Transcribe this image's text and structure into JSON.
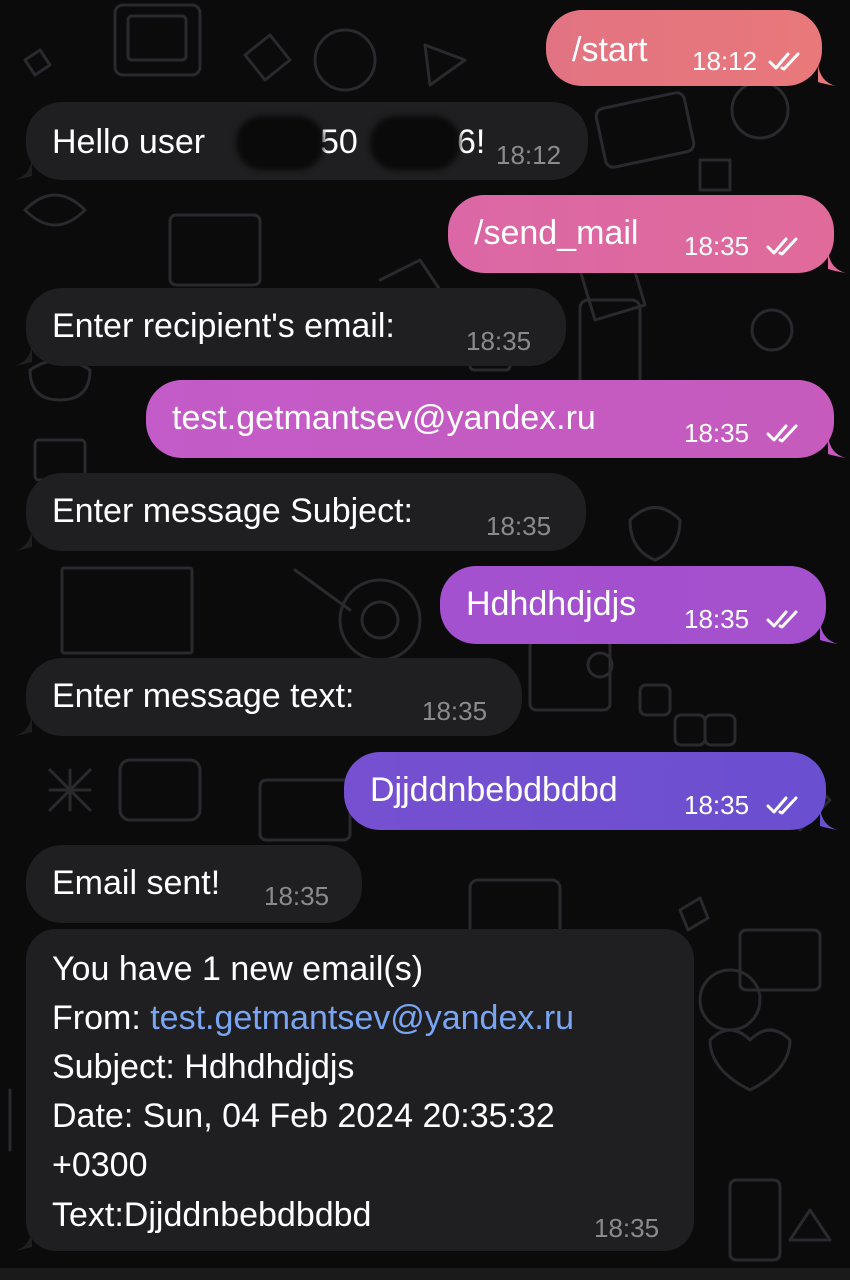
{
  "messages": [
    {
      "id": "m1",
      "dir": "out",
      "text": "/start",
      "time": "18:12"
    },
    {
      "id": "m2",
      "dir": "in",
      "text_start": "Hello user ",
      "text_mid": "50",
      "text_end": "6!",
      "time": "18:12"
    },
    {
      "id": "m3",
      "dir": "out",
      "text": "/send_mail",
      "time": "18:35"
    },
    {
      "id": "m4",
      "dir": "in",
      "text": "Enter recipient's email:",
      "time": "18:35"
    },
    {
      "id": "m5",
      "dir": "out",
      "text": "test.getmantsev@yandex.ru",
      "time": "18:35"
    },
    {
      "id": "m6",
      "dir": "in",
      "text": "Enter message Subject:",
      "time": "18:35"
    },
    {
      "id": "m7",
      "dir": "out",
      "text": "Hdhdhdjdjs",
      "time": "18:35"
    },
    {
      "id": "m8",
      "dir": "in",
      "text": "Enter message text:",
      "time": "18:35"
    },
    {
      "id": "m9",
      "dir": "out",
      "text": "Djjddnbebdbdbd",
      "time": "18:35"
    },
    {
      "id": "m10",
      "dir": "in",
      "text": "Email sent!",
      "time": "18:35"
    }
  ],
  "email_notice": {
    "line1": "You have 1 new email(s)",
    "from_label": "From: ",
    "from_email": "test.getmantsev@yandex.ru",
    "subject": "Subject: Hdhdhdjdjs",
    "date": "Date: Sun, 04 Feb 2024 20:35:32",
    "tz": "+0300",
    "text": "Text:Djjddnbebdbdbd",
    "time": "18:35"
  },
  "colors": {
    "background": "#0b0b0c",
    "incoming_bubble": "#1f1f21",
    "link": "#7aa5f2",
    "outgoing_gradient_top": "#e8787a",
    "outgoing_gradient_bottom": "#6a4fd0"
  },
  "icons": {
    "read_receipt": "double-check-icon",
    "background": "doodle-pattern"
  }
}
